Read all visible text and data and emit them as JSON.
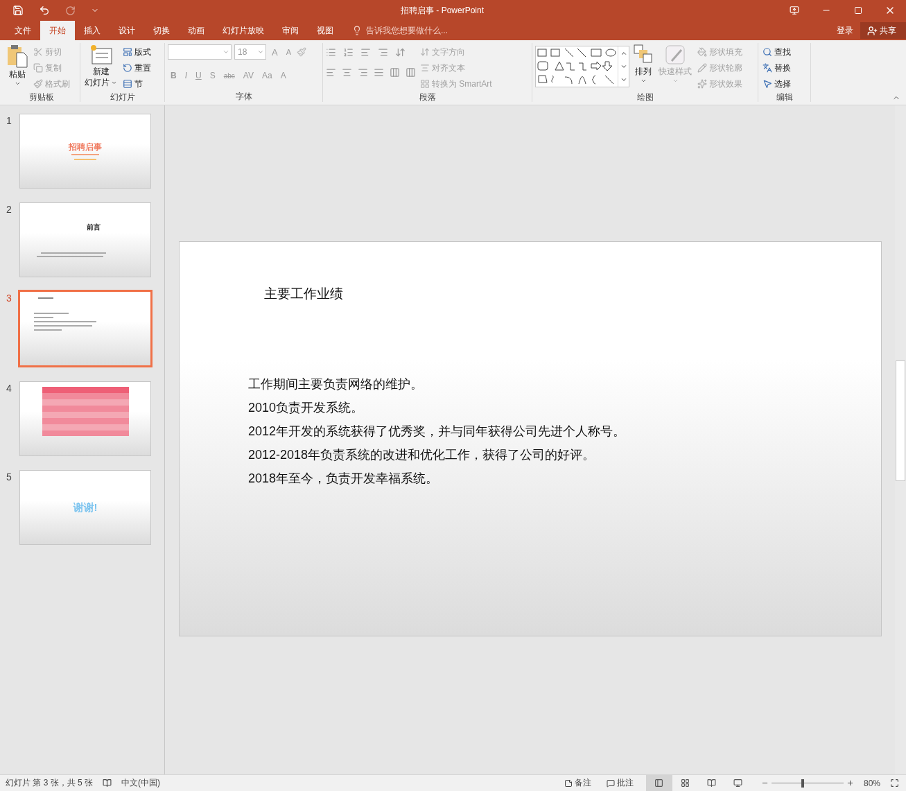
{
  "window": {
    "title": "招聘启事 - PowerPoint"
  },
  "tabs": [
    {
      "label": "文件",
      "selected": false
    },
    {
      "label": "开始",
      "selected": true
    },
    {
      "label": "插入",
      "selected": false
    },
    {
      "label": "设计",
      "selected": false
    },
    {
      "label": "切换",
      "selected": false
    },
    {
      "label": "动画",
      "selected": false
    },
    {
      "label": "幻灯片放映",
      "selected": false
    },
    {
      "label": "审阅",
      "selected": false
    },
    {
      "label": "视图",
      "selected": false
    }
  ],
  "tell_me": {
    "placeholder": "告诉我您想要做什么..."
  },
  "account": {
    "sign_in": "登录",
    "share": "共享"
  },
  "ribbon": {
    "clipboard": {
      "label": "剪贴板",
      "paste": "粘贴",
      "buttons": [
        {
          "label": "剪切",
          "disabled": true
        },
        {
          "label": "复制",
          "disabled": true
        },
        {
          "label": "格式刷",
          "disabled": true
        }
      ]
    },
    "slides": {
      "label": "幻灯片",
      "new_slide": [
        "新建",
        "幻灯片"
      ],
      "buttons": [
        {
          "label": "版式",
          "disabled": false
        },
        {
          "label": "重置",
          "disabled": false
        },
        {
          "label": "节",
          "disabled": false
        }
      ]
    },
    "font": {
      "label": "字体",
      "size": "18",
      "grow": "A",
      "shrink": "A",
      "format_buttons": [
        "B",
        "I",
        "U",
        "S",
        "abc",
        "AV",
        "Aa",
        "A"
      ]
    },
    "paragraph": {
      "label": "段落",
      "buttons": [
        {
          "label": "文字方向",
          "disabled": true
        },
        {
          "label": "对齐文本",
          "disabled": true
        },
        {
          "label": "转换为 SmartArt",
          "disabled": true
        }
      ]
    },
    "drawing": {
      "label": "绘图",
      "arrange": {
        "label": "排列",
        "disabled": false
      },
      "quick_styles": {
        "label": "快速样式",
        "disabled": true
      },
      "buttons": [
        {
          "label": "形状填充",
          "disabled": true
        },
        {
          "label": "形状轮廓",
          "disabled": true
        },
        {
          "label": "形状效果",
          "disabled": true
        }
      ]
    },
    "editing": {
      "label": "编辑",
      "buttons": [
        {
          "label": "查找",
          "disabled": false
        },
        {
          "label": "替换",
          "disabled": false
        },
        {
          "label": "选择",
          "disabled": false
        }
      ]
    }
  },
  "slides": [
    {
      "number": "1",
      "selected": false,
      "kind": "title",
      "title": "招聘启事"
    },
    {
      "number": "2",
      "selected": false,
      "kind": "heading",
      "title": "前言"
    },
    {
      "number": "3",
      "selected": true,
      "kind": "text"
    },
    {
      "number": "4",
      "selected": false,
      "kind": "table"
    },
    {
      "number": "5",
      "selected": false,
      "kind": "thanks",
      "title": "谢谢!"
    }
  ],
  "slide": {
    "title": "主要工作业绩",
    "lines": [
      "工作期间主要负责网络的维护。",
      "2010负责开发系统。",
      "2012年开发的系统获得了优秀奖，并与同年获得公司先进个人称号。",
      "2012-2018年负责系统的改进和优化工作，获得了公司的好评。",
      "2018年至今，负责开发幸福系统。"
    ]
  },
  "status_bar": {
    "slide_info": "幻灯片 第 3 张，共 5 张",
    "language": "中文(中国)",
    "notes": "备注",
    "comments": "批注",
    "views": [
      {
        "selected": true
      },
      {
        "selected": false
      },
      {
        "selected": false
      },
      {
        "selected": false
      }
    ],
    "zoom": {
      "level": 0.41,
      "reading": "80%"
    }
  }
}
